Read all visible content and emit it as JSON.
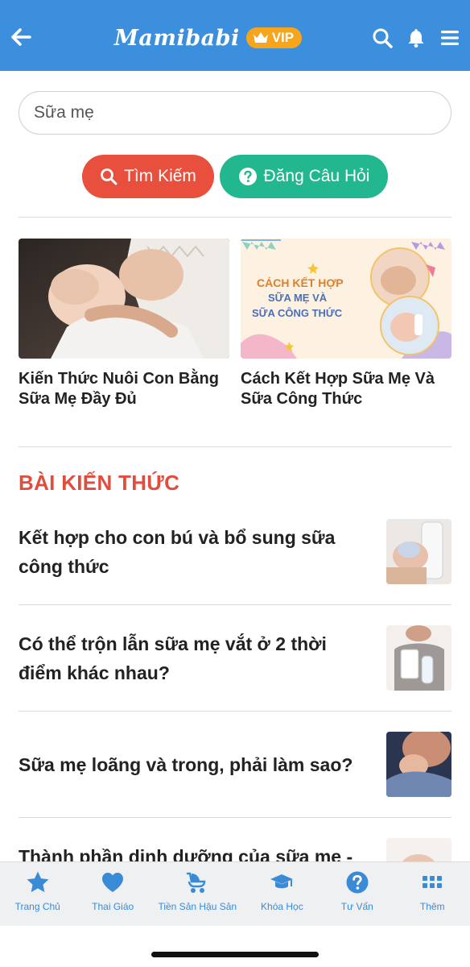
{
  "header": {
    "brand": "Mamibabi",
    "vip_label": "VIP"
  },
  "search": {
    "value": "Sữa mẹ",
    "search_button": "Tìm Kiếm",
    "ask_button": "Đăng Câu Hỏi"
  },
  "featured": [
    {
      "title": "Kiến Thức Nuôi Con Bằng Sữa Mẹ Đầy Đủ"
    },
    {
      "title": "Cách Kết Hợp Sữa Mẹ Và Sữa Công Thức",
      "banner_line1": "CÁCH KẾT HỢP",
      "banner_line2": "SỮA MẸ VÀ",
      "banner_line3": "SỮA CÔNG THỨC"
    }
  ],
  "section": {
    "title": "BÀI KIẾN THỨC"
  },
  "articles": [
    {
      "title": "Kết hợp cho con bú và bổ sung sữa công thức"
    },
    {
      "title": "Có thể trộn lẫn sữa mẹ vắt ở 2 thời điểm khác nhau?"
    },
    {
      "title": "Sữa mẹ loãng và trong, phải làm sao?"
    },
    {
      "title": "Thành phần dinh dưỡng của sữa mẹ -"
    }
  ],
  "bottom_nav": [
    {
      "label": "Trang Chủ",
      "icon": "star-icon"
    },
    {
      "label": "Thai Giáo",
      "icon": "heart-icon"
    },
    {
      "label": "Tiền Sản Hậu Sản",
      "icon": "stroller-icon"
    },
    {
      "label": "Khóa Học",
      "icon": "graduation-cap-icon"
    },
    {
      "label": "Tư Vấn",
      "icon": "question-icon"
    },
    {
      "label": "Thêm",
      "icon": "grid-icon"
    }
  ],
  "colors": {
    "header": "#3c8fdc",
    "vip": "#f7a51c",
    "search_button": "#e84f3d",
    "ask_button": "#23b78f",
    "section_title": "#e14c3c",
    "nav_accent": "#3a8bd6"
  }
}
